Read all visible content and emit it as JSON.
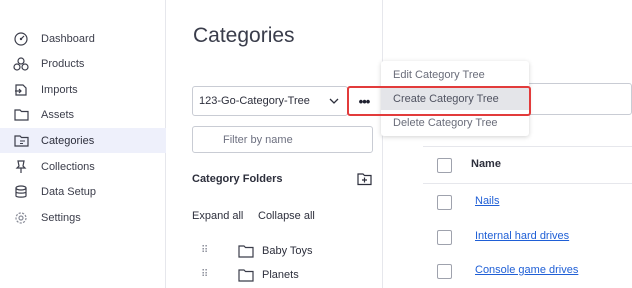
{
  "sidebar": {
    "items": [
      {
        "label": "Dashboard",
        "icon": "dashboard-icon"
      },
      {
        "label": "Products",
        "icon": "products-icon"
      },
      {
        "label": "Imports",
        "icon": "imports-icon"
      },
      {
        "label": "Assets",
        "icon": "folder-icon"
      },
      {
        "label": "Categories",
        "icon": "categories-icon",
        "active": true
      },
      {
        "label": "Collections",
        "icon": "collections-icon"
      },
      {
        "label": "Data Setup",
        "icon": "database-icon"
      },
      {
        "label": "Settings",
        "icon": "gear-icon"
      }
    ]
  },
  "categories": {
    "title": "Categories",
    "tree_select_value": "123-Go-Category-Tree",
    "more_label": "•••",
    "filter_placeholder": "Filter by name",
    "folders_heading": "Category Folders",
    "expand_all": "Expand all",
    "collapse_all": "Collapse all",
    "drag_glyph": "⠿",
    "folders": [
      {
        "name": "Baby Toys"
      },
      {
        "name": "Planets"
      }
    ]
  },
  "menu": {
    "items": [
      {
        "label": "Edit Category Tree"
      },
      {
        "label": "Create Category Tree",
        "hovered": true
      },
      {
        "label": "Delete Category Tree"
      }
    ]
  },
  "content": {
    "search_visible_text": "e",
    "table": {
      "column_name": "Name",
      "rows": [
        {
          "name": "Nails"
        },
        {
          "name": "Internal hard drives"
        },
        {
          "name": "Console game drives"
        }
      ]
    }
  },
  "colors": {
    "highlight": "#e23b3b",
    "link": "#1f5fd6",
    "active_nav_bg": "#eef0fb"
  }
}
